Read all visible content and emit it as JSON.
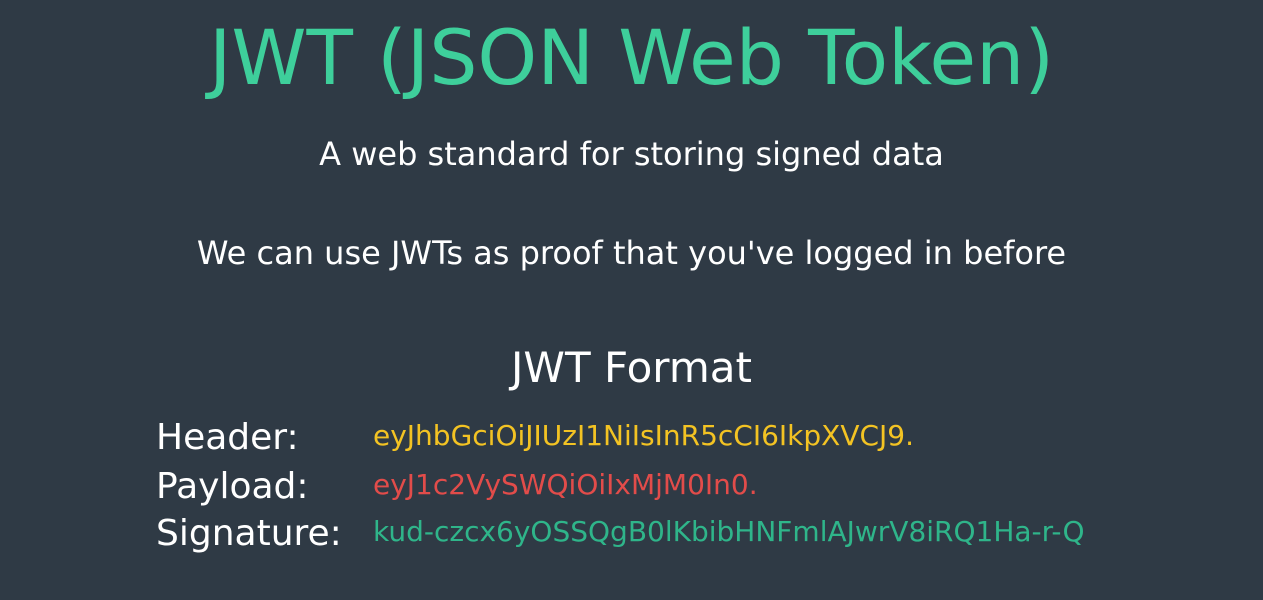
{
  "slide": {
    "title": "JWT (JSON Web Token)",
    "subtitle_line1": "A web standard for storing signed data",
    "subtitle_line2": "We can use JWTs as proof that you've logged in before",
    "section_title": "JWT Format"
  },
  "jwt_format": {
    "rows": [
      {
        "label": "Header:",
        "value": "eyJhbGciOiJIUzI1NiIsInR5cCI6IkpXVCJ9.",
        "color": "#f3c323"
      },
      {
        "label": "Payload:",
        "value": "eyJ1c2VySWQiOiIxMjM0In0.",
        "color": "#e24c4a"
      },
      {
        "label": "Signature:",
        "value": "kud-czcx6yOSSQgB0lKbibHNFmlAJwrV8iRQ1Ha-r-Q",
        "color": "#2fb58a"
      }
    ]
  },
  "colors": {
    "background": "#2f3a45",
    "title": "#3ecf9b",
    "text": "#ffffff"
  }
}
